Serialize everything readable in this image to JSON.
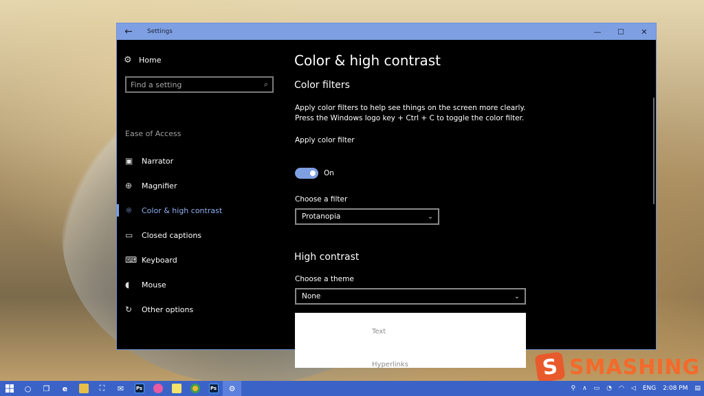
{
  "window": {
    "title": "Settings",
    "back_icon": "back-arrow-icon",
    "controls": [
      "minimize-icon",
      "maximize-icon",
      "close-icon"
    ]
  },
  "sidebar": {
    "home_label": "Home",
    "search_placeholder": "Find a setting",
    "section_label": "Ease of Access",
    "items": [
      {
        "label": "Narrator",
        "icon": "narrator-icon",
        "active": false
      },
      {
        "label": "Magnifier",
        "icon": "magnifier-icon",
        "active": false
      },
      {
        "label": "Color & high contrast",
        "icon": "brightness-icon",
        "active": true
      },
      {
        "label": "Closed captions",
        "icon": "captions-icon",
        "active": false
      },
      {
        "label": "Keyboard",
        "icon": "keyboard-icon",
        "active": false
      },
      {
        "label": "Mouse",
        "icon": "mouse-icon",
        "active": false
      },
      {
        "label": "Other options",
        "icon": "options-icon",
        "active": false
      }
    ]
  },
  "content": {
    "page_title": "Color & high contrast",
    "color_filters_heading": "Color filters",
    "description_line1": "Apply color filters to help see things on the screen more clearly.",
    "description_line2": "Press the Windows logo key + Ctrl + C to toggle the color filter.",
    "apply_filter_label": "Apply color filter",
    "toggle_state": "On",
    "choose_filter_label": "Choose a filter",
    "filter_value": "Protanopia",
    "high_contrast_heading": "High contrast",
    "choose_theme_label": "Choose a theme",
    "theme_value": "None",
    "preview_text": "Text",
    "preview_hyperlinks": "Hyperlinks"
  },
  "watermark": {
    "badge": "S",
    "word": "SMASHING"
  },
  "taskbar": {
    "language": "ENG",
    "time": "2:08 PM"
  },
  "colors": {
    "accent": "#7ea0e3",
    "taskbar": "#3b63c7",
    "window_bg": "#000000"
  }
}
